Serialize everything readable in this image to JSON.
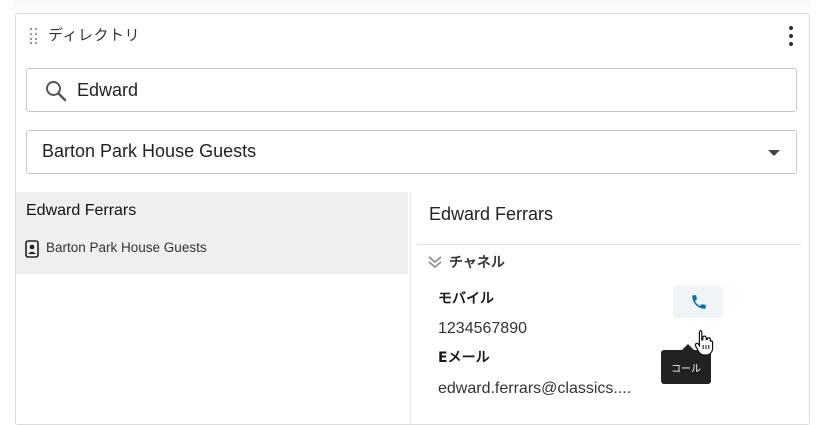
{
  "widget": {
    "title": "ディレクトリ",
    "menu_icon": "more-vertical-icon",
    "drag_icon": "drag-handle-icon"
  },
  "search": {
    "value": "Edward",
    "icon": "search-icon"
  },
  "filter": {
    "selected": "Barton Park House Guests"
  },
  "results": [
    {
      "name": "Edward Ferrars",
      "group": "Barton Park House Guests",
      "icon": "contact-card-icon"
    }
  ],
  "detail": {
    "name": "Edward Ferrars",
    "section_title": "チャネル",
    "mobile_label": "モバイル",
    "mobile_value": "1234567890",
    "email_label": "Eメール",
    "email_value": "edward.ferrars@classics....",
    "call_tooltip": "コール"
  },
  "colors": {
    "accent": "#0b6fa8",
    "selected_row": "#efefef",
    "tooltip_bg": "#222222"
  }
}
